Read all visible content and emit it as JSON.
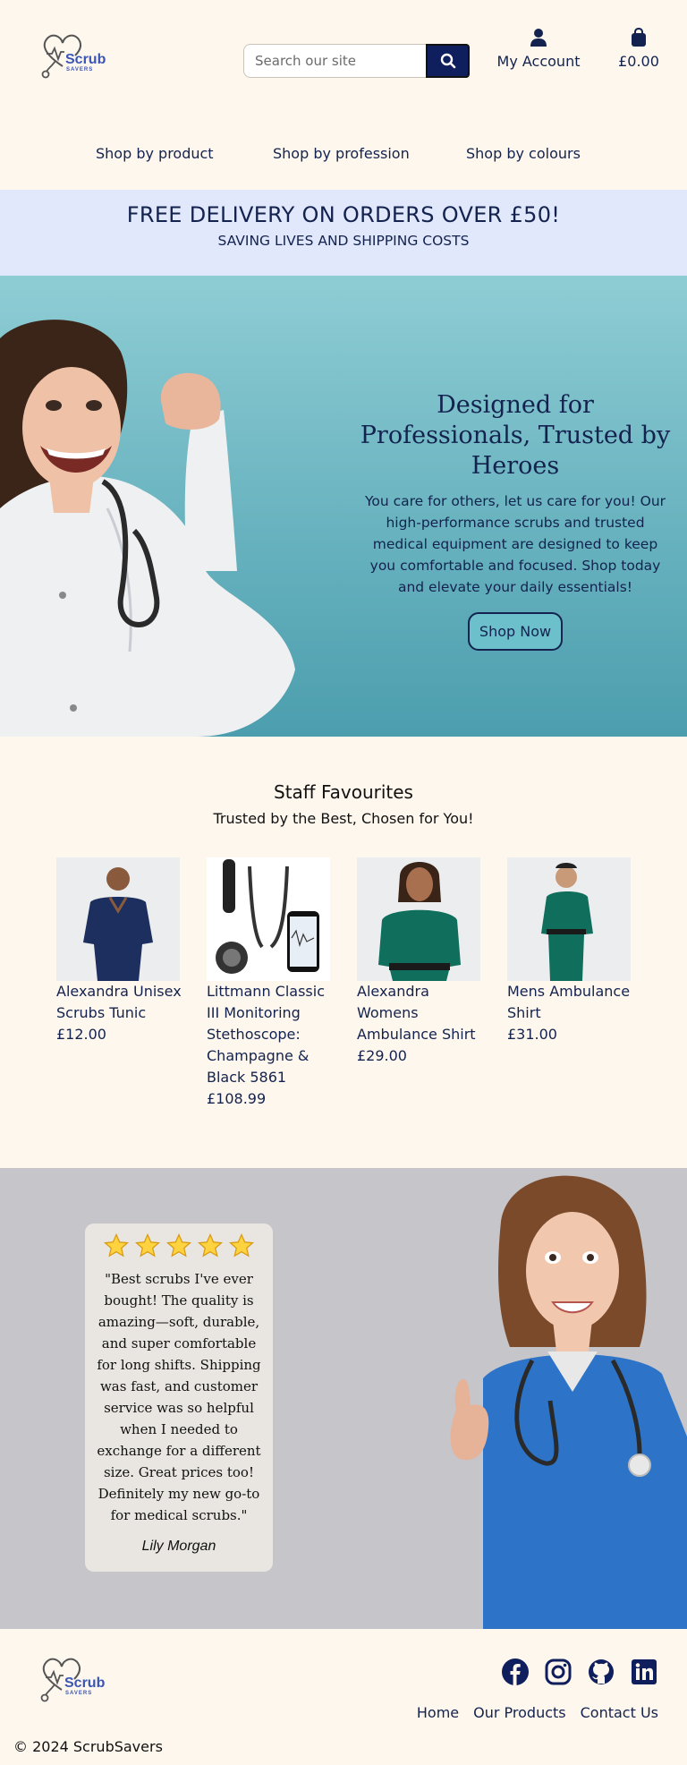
{
  "header": {
    "logo": {
      "text": "Scrub",
      "sub": "SAVERS"
    },
    "search": {
      "placeholder": "Search our site"
    },
    "account_label": "My Account",
    "cart_total": "£0.00"
  },
  "nav": {
    "items": [
      "Shop by product",
      "Shop by profession",
      "Shop by colours"
    ]
  },
  "banner": {
    "title": "FREE DELIVERY ON ORDERS OVER £50!",
    "subtitle": "SAVING LIVES AND SHIPPING COSTS"
  },
  "hero": {
    "title": "Designed for Professionals, Trusted by Heroes",
    "body": "You care for others, let us care for you! Our high-performance scrubs and trusted medical equipment are designed to keep you comfortable and focused. Shop today and elevate your daily essentials!",
    "cta": "Shop Now"
  },
  "favourites": {
    "title": "Staff Favourites",
    "subtitle": "Trusted by the Best, Chosen for You!",
    "products": [
      {
        "name": "Alexandra Unisex Scrubs Tunic",
        "price": "£12.00"
      },
      {
        "name": "Littmann Classic III Monitoring Stethoscope: Champagne & Black 5861",
        "price": "£108.99"
      },
      {
        "name": "Alexandra Womens Ambulance Shirt",
        "price": "£29.00"
      },
      {
        "name": "Mens Ambulance Shirt",
        "price": "£31.00"
      }
    ]
  },
  "testimonial": {
    "rating": 5,
    "quote": "\"Best scrubs I've ever bought! The quality is amazing—soft, durable, and super comfortable for long shifts. Shipping was fast, and customer service was so helpful when I needed to exchange for a different size. Great prices too! Definitely my new go-to for medical scrubs.\"",
    "author": "Lily Morgan"
  },
  "footer": {
    "links": [
      "Home",
      "Our Products",
      "Contact Us"
    ],
    "copyright": "© 2024 ScrubSavers",
    "socials": [
      "facebook-icon",
      "instagram-icon",
      "github-icon",
      "linkedin-icon"
    ]
  },
  "colors": {
    "navy": "#0f1e5c",
    "cream": "#fdf7ee",
    "banner_blue": "#e1e8fb",
    "teal": "#6fb7c3",
    "logo_blue": "#3a55b5"
  }
}
